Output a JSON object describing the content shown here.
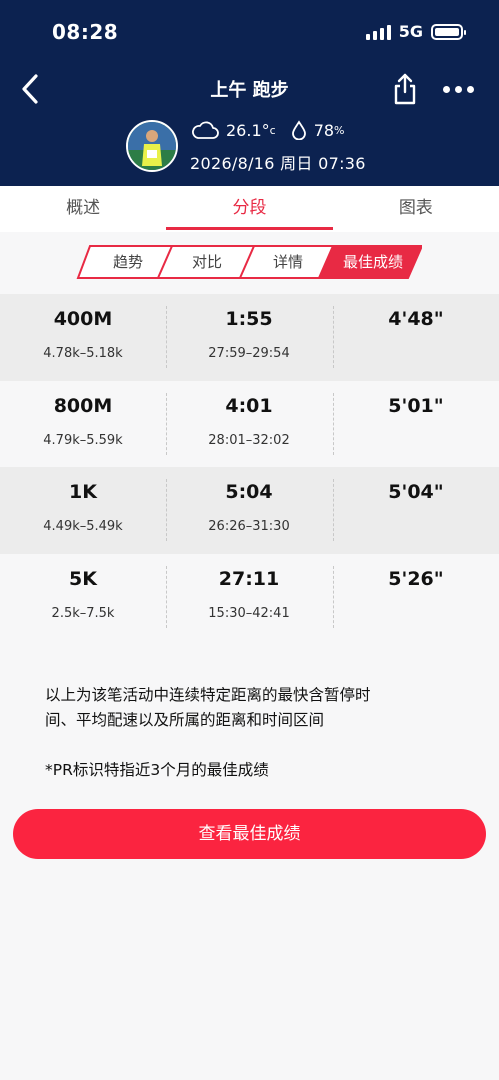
{
  "status_bar": {
    "time": "08:28",
    "network": "5G"
  },
  "header": {
    "title": "上午 跑步",
    "temperature": "26.1°",
    "temperature_unit": "c",
    "humidity": "78",
    "humidity_unit": "%",
    "datetime": "2026/8/16 周日 07:36",
    "colors": {
      "background": "#0c2250",
      "text": "#ffffff"
    }
  },
  "tabs": [
    {
      "label": "概述",
      "active": false
    },
    {
      "label": "分段",
      "active": true
    },
    {
      "label": "图表",
      "active": false
    }
  ],
  "segments": [
    {
      "label": "趋势",
      "active": false
    },
    {
      "label": "对比",
      "active": false
    },
    {
      "label": "详情",
      "active": false
    },
    {
      "label": "最佳成绩",
      "active": true
    }
  ],
  "records": [
    {
      "distance": "400M",
      "range": "4.78k–5.18k",
      "time": "1:55",
      "time_range": "27:59–29:54",
      "pace": "4'48\""
    },
    {
      "distance": "800M",
      "range": "4.79k–5.59k",
      "time": "4:01",
      "time_range": "28:01–32:02",
      "pace": "5'01\""
    },
    {
      "distance": "1K",
      "range": "4.49k–5.49k",
      "time": "5:04",
      "time_range": "26:26–31:30",
      "pace": "5'04\""
    },
    {
      "distance": "5K",
      "range": "2.5k–7.5k",
      "time": "27:11",
      "time_range": "15:30–42:41",
      "pace": "5'26\""
    }
  ],
  "notes": {
    "line1": "以上为该笔活动中连续特定距离的最快含暂停时",
    "line2": "间、平均配速以及所属的距离和时间区间",
    "pr_note": "*PR标识特指近3个月的最佳成绩"
  },
  "cta": {
    "label": "查看最佳成绩"
  },
  "accent_color": "#e82a44",
  "icons": [
    "back-icon",
    "share-icon",
    "more-icon",
    "cloud-icon",
    "water-drop-icon",
    "signal-icon",
    "battery-icon"
  ]
}
